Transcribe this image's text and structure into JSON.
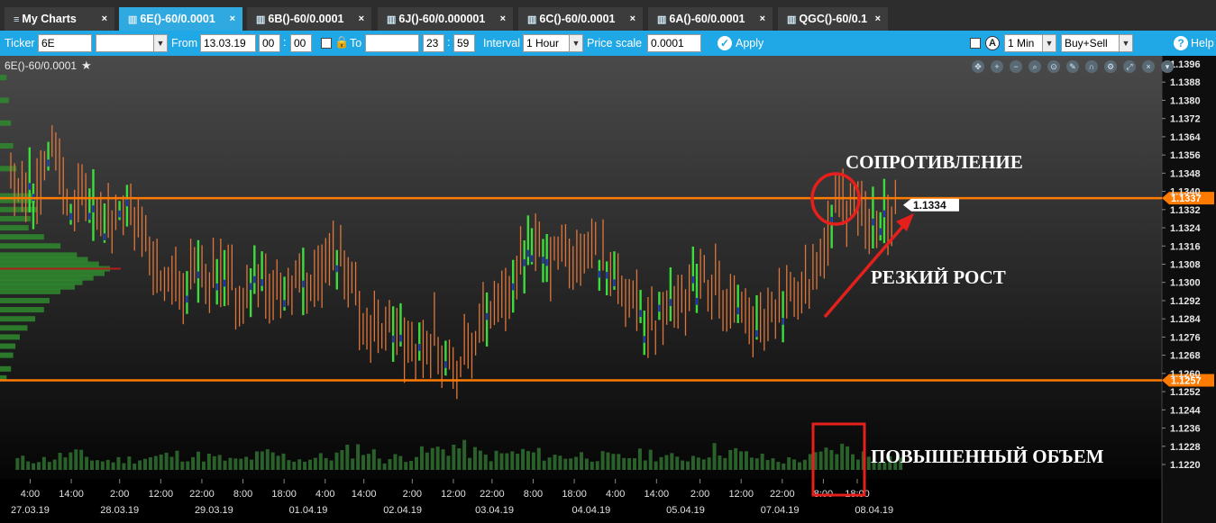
{
  "tabs": [
    {
      "label": "My Charts",
      "icon": "list-icon",
      "active": false
    },
    {
      "label": "6E()-60/0.0001",
      "icon": "bar-chart-icon",
      "active": true
    },
    {
      "label": "6B()-60/0.0001",
      "icon": "bar-chart-icon",
      "active": false
    },
    {
      "label": "6J()-60/0.000001",
      "icon": "bar-chart-icon",
      "active": false
    },
    {
      "label": "6C()-60/0.0001",
      "icon": "bar-chart-icon",
      "active": false
    },
    {
      "label": "6A()-60/0.0001",
      "icon": "bar-chart-icon",
      "active": false
    },
    {
      "label": "QGC()-60/0.1",
      "icon": "bar-chart-icon",
      "active": false
    }
  ],
  "tab_close": "×",
  "toolbar": {
    "ticker_label": "Ticker",
    "ticker_value": "6E",
    "ticker_select": "",
    "from_label": "From",
    "from_date": "13.03.19",
    "from_hour": "00",
    "from_min": "00",
    "to_label": "To",
    "to_date": "",
    "to_hour": "23",
    "to_min": "59",
    "interval_label": "Interval",
    "interval_value": "1 Hour",
    "price_scale_label": "Price scale",
    "price_scale_value": "0.0001",
    "apply_label": "Apply",
    "tf_value": "1 Min",
    "side_value": "Buy+Sell",
    "help_label": "Help"
  },
  "chart_title": "6E()-60/0.0001",
  "chart_data": {
    "type": "candlestick",
    "instrument": "6E()-60/0.0001",
    "ylim": [
      1.1214,
      1.14
    ],
    "y_ticks": [
      1.1396,
      1.1388,
      1.138,
      1.1372,
      1.1364,
      1.1356,
      1.1348,
      1.134,
      1.1332,
      1.1324,
      1.1316,
      1.1308,
      1.13,
      1.1292,
      1.1284,
      1.1276,
      1.1268,
      1.126,
      1.1252,
      1.1244,
      1.1236,
      1.1228,
      1.122
    ],
    "y_tick_labels": [
      "1.1396",
      "1.1388",
      "1.1380",
      "1.1372",
      "1.1364",
      "1.1356",
      "1.1348",
      "1.1340",
      "1.1332",
      "1.1324",
      "1.1316",
      "1.1308",
      "1.1300",
      "1.1292",
      "1.1284",
      "1.1276",
      "1.1268",
      "1.1260",
      "1.1252",
      "1.1244",
      "1.1236",
      "1.1228",
      "1.1220"
    ],
    "x_time_labels": [
      {
        "t": 0.8,
        "label": "4:00"
      },
      {
        "t": 2.5,
        "label": "14:00"
      },
      {
        "t": 4.5,
        "label": "2:00"
      },
      {
        "t": 6.2,
        "label": "12:00"
      },
      {
        "t": 7.9,
        "label": "22:00"
      },
      {
        "t": 9.6,
        "label": "8:00"
      },
      {
        "t": 11.3,
        "label": "18:00"
      },
      {
        "t": 13.0,
        "label": "4:00"
      },
      {
        "t": 14.6,
        "label": "14:00"
      },
      {
        "t": 16.6,
        "label": "2:00"
      },
      {
        "t": 18.3,
        "label": "12:00"
      },
      {
        "t": 19.9,
        "label": "22:00"
      },
      {
        "t": 21.6,
        "label": "8:00"
      },
      {
        "t": 23.3,
        "label": "18:00"
      },
      {
        "t": 25.0,
        "label": "4:00"
      },
      {
        "t": 26.7,
        "label": "14:00"
      },
      {
        "t": 28.5,
        "label": "2:00"
      },
      {
        "t": 30.2,
        "label": "12:00"
      },
      {
        "t": 31.9,
        "label": "22:00"
      },
      {
        "t": 33.6,
        "label": "8:00"
      },
      {
        "t": 35.0,
        "label": "18:00"
      }
    ],
    "x_date_labels": [
      {
        "t": 0.8,
        "label": "27.03.19"
      },
      {
        "t": 4.5,
        "label": "28.03.19"
      },
      {
        "t": 8.4,
        "label": "29.03.19"
      },
      {
        "t": 12.3,
        "label": "01.04.19"
      },
      {
        "t": 16.2,
        "label": "02.04.19"
      },
      {
        "t": 20.0,
        "label": "03.04.19"
      },
      {
        "t": 24.0,
        "label": "04.04.19"
      },
      {
        "t": 27.9,
        "label": "05.04.19"
      },
      {
        "t": 31.8,
        "label": "07.04.19"
      },
      {
        "t": 35.7,
        "label": "08.04.19"
      }
    ],
    "price_path": [
      [
        0.0,
        1.1345
      ],
      [
        1.0,
        1.134
      ],
      [
        1.7,
        1.1362
      ],
      [
        2.0,
        1.1352
      ],
      [
        2.4,
        1.133
      ],
      [
        2.8,
        1.1338
      ],
      [
        3.2,
        1.133
      ],
      [
        3.8,
        1.1324
      ],
      [
        4.6,
        1.1332
      ],
      [
        5.2,
        1.133
      ],
      [
        5.6,
        1.132
      ],
      [
        6.1,
        1.13
      ],
      [
        6.6,
        1.13
      ],
      [
        7.2,
        1.1298
      ],
      [
        7.8,
        1.1302
      ],
      [
        8.4,
        1.13
      ],
      [
        9.0,
        1.13
      ],
      [
        9.6,
        1.129
      ],
      [
        10.2,
        1.1308
      ],
      [
        10.6,
        1.1298
      ],
      [
        11.2,
        1.1294
      ],
      [
        11.8,
        1.1302
      ],
      [
        12.3,
        1.13
      ],
      [
        12.8,
        1.1306
      ],
      [
        13.3,
        1.1314
      ],
      [
        14.0,
        1.1306
      ],
      [
        14.5,
        1.1284
      ],
      [
        15.0,
        1.1278
      ],
      [
        15.6,
        1.1282
      ],
      [
        16.3,
        1.127
      ],
      [
        16.9,
        1.127
      ],
      [
        17.5,
        1.1276
      ],
      [
        18.0,
        1.127
      ],
      [
        18.4,
        1.126
      ],
      [
        18.9,
        1.1268
      ],
      [
        19.5,
        1.1282
      ],
      [
        20.0,
        1.1294
      ],
      [
        20.6,
        1.1292
      ],
      [
        21.2,
        1.1316
      ],
      [
        21.7,
        1.1316
      ],
      [
        22.2,
        1.1306
      ],
      [
        22.7,
        1.1314
      ],
      [
        23.2,
        1.131
      ],
      [
        23.7,
        1.1312
      ],
      [
        24.2,
        1.1312
      ],
      [
        24.8,
        1.1306
      ],
      [
        25.3,
        1.13
      ],
      [
        25.8,
        1.1286
      ],
      [
        26.3,
        1.128
      ],
      [
        26.8,
        1.1286
      ],
      [
        27.3,
        1.1292
      ],
      [
        27.9,
        1.1296
      ],
      [
        28.4,
        1.1298
      ],
      [
        28.9,
        1.13
      ],
      [
        29.4,
        1.1294
      ],
      [
        29.8,
        1.1286
      ],
      [
        30.3,
        1.1282
      ],
      [
        30.8,
        1.1282
      ],
      [
        31.3,
        1.1286
      ],
      [
        31.8,
        1.1288
      ],
      [
        32.2,
        1.1292
      ],
      [
        32.8,
        1.1296
      ],
      [
        33.3,
        1.1306
      ],
      [
        33.7,
        1.1322
      ],
      [
        34.0,
        1.1336
      ],
      [
        34.3,
        1.1338
      ],
      [
        34.7,
        1.1334
      ],
      [
        35.2,
        1.133
      ],
      [
        35.7,
        1.1326
      ],
      [
        36.1,
        1.1328
      ],
      [
        36.6,
        1.1334
      ]
    ],
    "volume_path": [
      [
        1.4,
        0.35
      ],
      [
        2.5,
        0.55
      ],
      [
        3.7,
        0.3
      ],
      [
        5.6,
        0.4
      ],
      [
        6.6,
        0.5
      ],
      [
        8.0,
        0.45
      ],
      [
        9.2,
        0.3
      ],
      [
        10.6,
        0.55
      ],
      [
        11.8,
        0.35
      ],
      [
        13.2,
        0.45
      ],
      [
        14.4,
        0.75
      ],
      [
        15.4,
        0.35
      ],
      [
        16.9,
        0.55
      ],
      [
        18.3,
        0.8
      ],
      [
        19.6,
        0.45
      ],
      [
        21.2,
        0.6
      ],
      [
        22.4,
        0.45
      ],
      [
        23.6,
        0.5
      ],
      [
        25.0,
        0.4
      ],
      [
        26.4,
        0.55
      ],
      [
        27.6,
        0.35
      ],
      [
        29.2,
        0.7
      ],
      [
        30.6,
        0.45
      ],
      [
        31.8,
        0.3
      ],
      [
        33.0,
        0.4
      ],
      [
        34.2,
        0.75
      ],
      [
        35.6,
        0.4
      ]
    ],
    "volume_profile": [
      [
        1.1338,
        0.3
      ],
      [
        1.1336,
        0.32
      ],
      [
        1.1332,
        0.34
      ],
      [
        1.1328,
        0.28
      ],
      [
        1.1324,
        0.26
      ],
      [
        1.132,
        0.4
      ],
      [
        1.1316,
        0.55
      ],
      [
        1.1312,
        0.7
      ],
      [
        1.131,
        0.8
      ],
      [
        1.1308,
        0.9
      ],
      [
        1.1306,
        1.0
      ],
      [
        1.1304,
        0.95
      ],
      [
        1.1302,
        0.85
      ],
      [
        1.13,
        0.75
      ],
      [
        1.1298,
        0.68
      ],
      [
        1.1296,
        0.55
      ],
      [
        1.1292,
        0.45
      ],
      [
        1.1288,
        0.4
      ],
      [
        1.1284,
        0.32
      ],
      [
        1.128,
        0.25
      ],
      [
        1.1276,
        0.18
      ],
      [
        1.1272,
        0.14
      ],
      [
        1.1268,
        0.12
      ],
      [
        1.1262,
        0.1
      ],
      [
        1.1258,
        0.06
      ],
      [
        1.135,
        0.15
      ],
      [
        1.136,
        0.12
      ],
      [
        1.137,
        0.1
      ],
      [
        1.138,
        0.08
      ],
      [
        1.139,
        0.06
      ]
    ],
    "poc_price": 1.1306,
    "levels": [
      {
        "price": 1.1337,
        "label": "1.1337",
        "color": "#ff7a00"
      },
      {
        "price": 1.1257,
        "label": "1.1257",
        "color": "#ff7a00"
      }
    ],
    "last_price_label": "1.1334",
    "annotations": [
      {
        "text": "СОПРОТИВЛЕНИЕ"
      },
      {
        "text": "РЕЗКИЙ РОСТ"
      },
      {
        "text": "ПОВЫШЕННЫЙ ОБЪЕМ"
      }
    ],
    "colors": {
      "up": "#3ddc3d",
      "down": "#e0763a",
      "level": "#ff7a00",
      "annotation": "#e5201c",
      "volume": "#2f6a2f",
      "profile": "#2f8a2f",
      "accent": "#20a7e6"
    }
  }
}
